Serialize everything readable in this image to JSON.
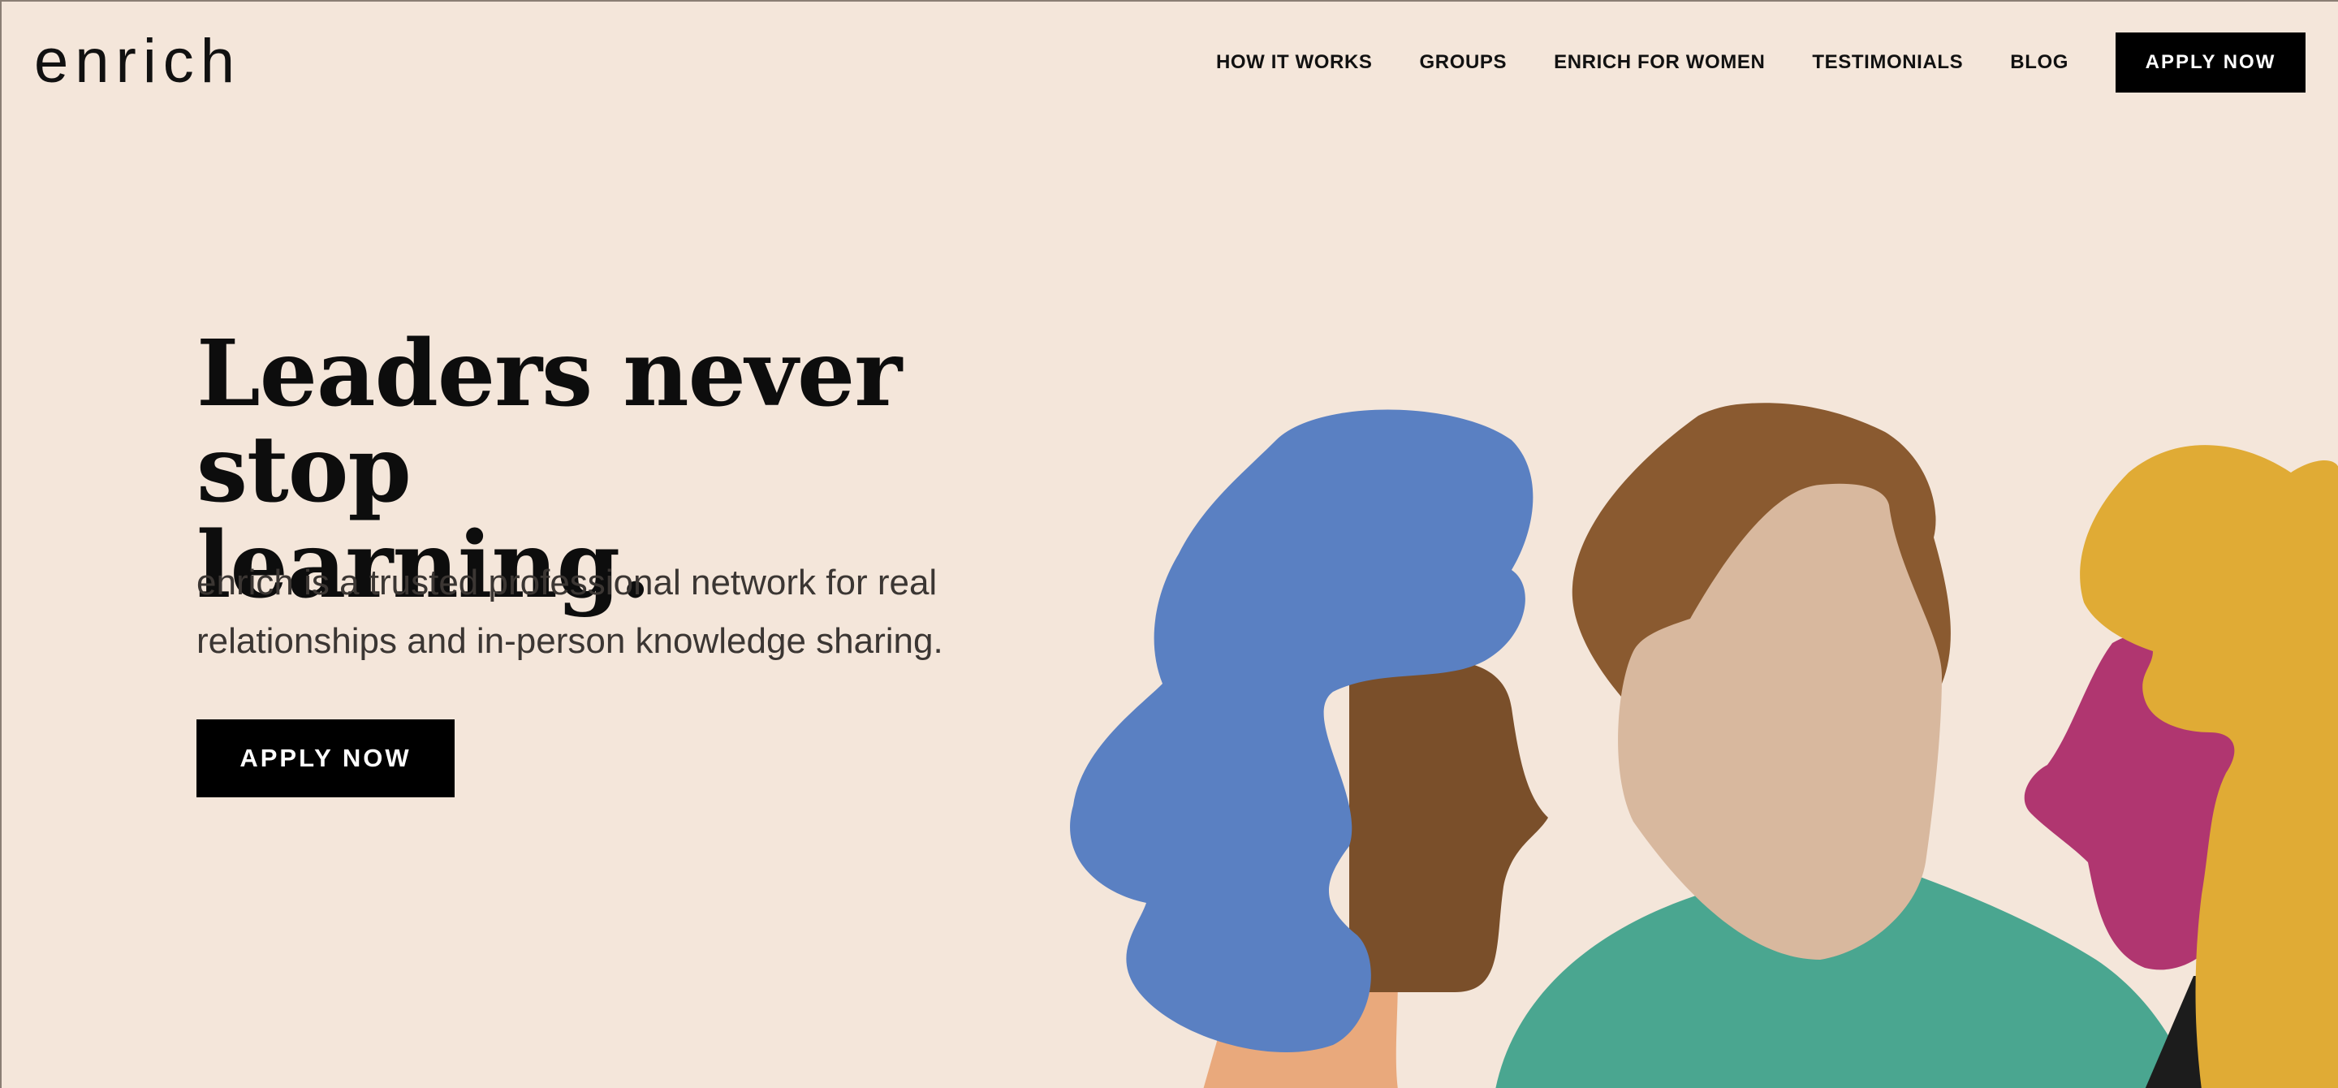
{
  "header": {
    "logo": "enrich",
    "nav": [
      {
        "label": "HOW IT WORKS"
      },
      {
        "label": "GROUPS"
      },
      {
        "label": "ENRICH FOR WOMEN"
      },
      {
        "label": "TESTIMONIALS"
      },
      {
        "label": "BLOG"
      }
    ],
    "cta": "APPLY NOW"
  },
  "hero": {
    "title_line1": "Leaders never stop",
    "title_line2": "learning.",
    "subtitle_line1": "enrich is a trusted professional network for real",
    "subtitle_line2": "relationships and in-person knowledge sharing.",
    "cta": "APPLY NOW"
  },
  "colors": {
    "background": "#f4e6da",
    "button": "#000000",
    "blue_hair": "#5a80c2",
    "brown_hair": "#7a4f2a",
    "skin_light": "#d8b89e",
    "skin_peach": "#e9a97c",
    "teal_shirt": "#4aa690",
    "magenta": "#b03670",
    "mustard_hair": "#e0ab35"
  }
}
